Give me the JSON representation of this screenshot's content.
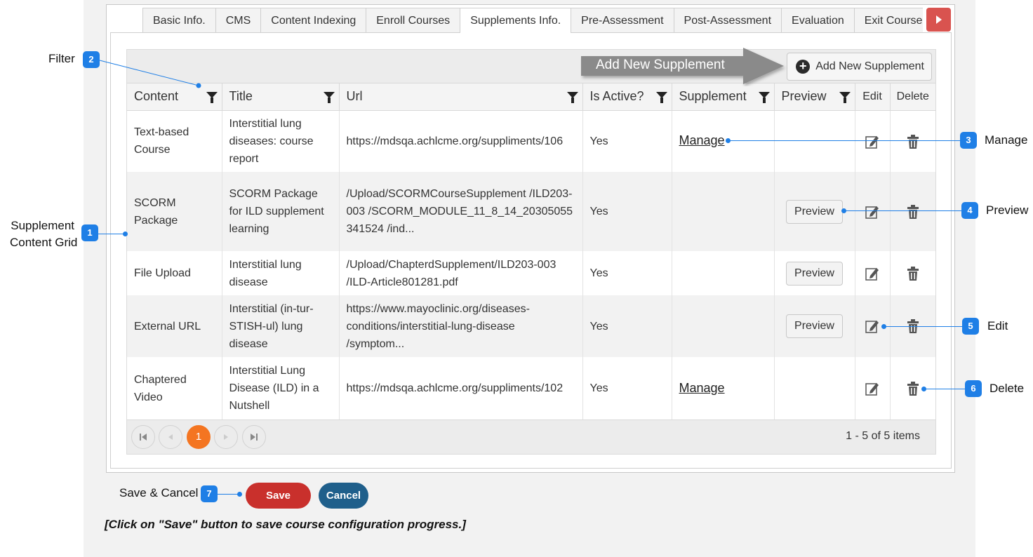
{
  "tabs": [
    "Basic Info.",
    "CMS",
    "Content Indexing",
    "Enroll Courses",
    "Supplements Info.",
    "Pre-Assessment",
    "Post-Assessment",
    "Evaluation",
    "Exit Course F"
  ],
  "active_tab": "Supplements Info.",
  "toolbar": {
    "arrow_label": "Add New Supplement",
    "add_button_label": "Add New Supplement"
  },
  "grid": {
    "columns": [
      "Content",
      "Title",
      "Url",
      "Is Active?",
      "Supplement",
      "Preview",
      "Edit",
      "Delete"
    ],
    "rows": [
      {
        "content": "Text-based Course",
        "title": "Interstitial lung diseases: course report",
        "url": "https://mdsqa.achlcme.org/suppliments/106",
        "active": "Yes",
        "supplement": "Manage",
        "preview": ""
      },
      {
        "content": "SCORM Package",
        "title": "SCORM Package for ILD supplement learning",
        "url": "/Upload/SCORMCourseSupplement /ILD203-003 /SCORM_MODULE_11_8_14_20305055341524 /ind...",
        "active": "Yes",
        "supplement": "",
        "preview": "Preview"
      },
      {
        "content": "File Upload",
        "title": "Interstitial lung disease",
        "url": "/Upload/ChapterdSupplement/ILD203-003 /ILD-Article801281.pdf",
        "active": "Yes",
        "supplement": "",
        "preview": "Preview"
      },
      {
        "content": "External URL",
        "title": "Interstitial (in-tur-STISH-ul) lung disease",
        "url": "https://www.mayoclinic.org/diseases-conditions/interstitial-lung-disease /symptom...",
        "active": "Yes",
        "supplement": "",
        "preview": "Preview"
      },
      {
        "content": "Chaptered Video",
        "title": "Interstitial Lung Disease (ILD) in a Nutshell",
        "url": "https://mdsqa.achlcme.org/suppliments/102",
        "active": "Yes",
        "supplement": "Manage",
        "preview": ""
      }
    ]
  },
  "pager": {
    "current_page": "1",
    "info": "1 - 5 of 5 items"
  },
  "callouts": {
    "c1": {
      "num": "1",
      "label1": "Supplement",
      "label2": "Content Grid"
    },
    "c2": {
      "num": "2",
      "label": "Filter"
    },
    "c3": {
      "num": "3",
      "label": "Manage"
    },
    "c4": {
      "num": "4",
      "label": "Preview"
    },
    "c5": {
      "num": "5",
      "label": "Edit"
    },
    "c6": {
      "num": "6",
      "label": "Delete"
    },
    "c7": {
      "num": "7",
      "label": "Save & Cancel"
    }
  },
  "buttons": {
    "save": "Save",
    "cancel": "Cancel"
  },
  "note": "[Click on \"Save\" button to save course configuration progress.]",
  "colors": {
    "accent": "#1f7fe6",
    "save": "#c9302c",
    "cancel": "#1f5f8b",
    "page_current": "#f47521",
    "tab_arrow": "#d9534f"
  }
}
